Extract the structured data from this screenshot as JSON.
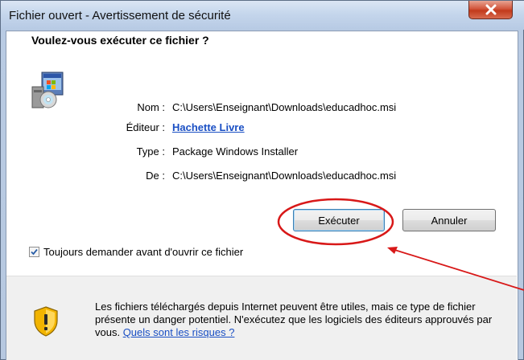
{
  "window": {
    "title": "Fichier ouvert - Avertissement de sécurité"
  },
  "heading": "Voulez-vous exécuter ce fichier ?",
  "file_info": {
    "name_label": "Nom :",
    "name_value": "C:\\Users\\Enseignant\\Downloads\\educadhoc.msi",
    "publisher_label": "Éditeur :",
    "publisher_value": "Hachette Livre",
    "type_label": "Type :",
    "type_value": "Package Windows Installer",
    "from_label": "De :",
    "from_value": "C:\\Users\\Enseignant\\Downloads\\educadhoc.msi"
  },
  "buttons": {
    "run": "Exécuter",
    "cancel": "Annuler"
  },
  "checkbox": {
    "label": "Toujours demander avant d'ouvrir ce fichier",
    "checked": true
  },
  "warning": {
    "text": "Les fichiers téléchargés depuis Internet peuvent être utiles, mais ce type de fichier présente un danger potentiel. N'exécutez que les logiciels des éditeurs approuvés par vous. ",
    "link": "Quels sont les risques ?"
  },
  "colors": {
    "annotation": "#d81818",
    "link": "#1a4fc4",
    "close_button": "#c8462a"
  }
}
